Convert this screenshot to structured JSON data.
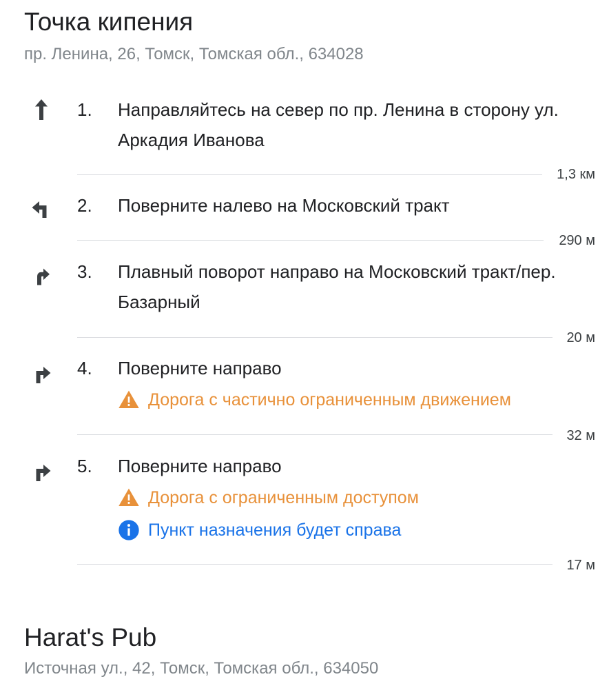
{
  "origin": {
    "name": "Точка кипения",
    "address": "пр. Ленина, 26, Томск, Томская обл., 634028"
  },
  "steps": [
    {
      "number": "1.",
      "icon": "arrow-up-icon",
      "text": "Направляйтесь на север по пр. Ленина в сторону ул. Аркадия Иванова",
      "distance": "1,3 км"
    },
    {
      "number": "2.",
      "icon": "turn-left-icon",
      "text": "Поверните налево на Московский тракт",
      "distance": "290 м"
    },
    {
      "number": "3.",
      "icon": "slight-right-icon",
      "text": "Плавный поворот направо на Московский тракт/пер. Базарный",
      "distance": "20 м"
    },
    {
      "number": "4.",
      "icon": "turn-right-icon",
      "text": "Поверните направо",
      "notes": [
        {
          "type": "warning",
          "icon": "warning-icon",
          "text": "Дорога с частично ограниченным движением"
        }
      ],
      "distance": "32 м"
    },
    {
      "number": "5.",
      "icon": "turn-right-icon",
      "text": "Поверните направо",
      "notes": [
        {
          "type": "warning",
          "icon": "warning-icon",
          "text": "Дорога с ограниченным доступом"
        },
        {
          "type": "info",
          "icon": "info-icon",
          "text": "Пункт назначения будет справа"
        }
      ],
      "distance": "17 м"
    }
  ],
  "destination": {
    "name": "Harat's Pub",
    "address": "Источная ул., 42, Томск, Томская обл., 634050"
  },
  "colors": {
    "warning": "#e8913a",
    "info": "#1a73e8",
    "divider": "#dadce0"
  }
}
